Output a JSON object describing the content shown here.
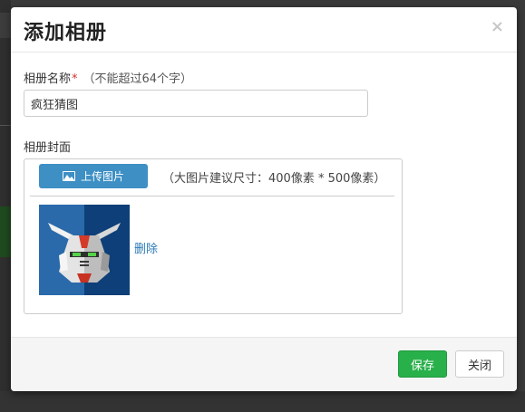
{
  "modal": {
    "title": "添加相册",
    "close_glyph": "×"
  },
  "form": {
    "name_label": "相册名称",
    "required_mark": "*",
    "name_hint": "（不能超过64个字）",
    "name_value": "疯狂猜图",
    "cover_label": "相册封面",
    "upload_button_label": "上传图片",
    "upload_icon": "image-icon",
    "upload_hint": "（大图片建议尺寸：400像素 * 500像素）",
    "delete_label": "删除"
  },
  "footer": {
    "save_label": "保存",
    "close_label": "关闭"
  },
  "colors": {
    "primary": "#3d8fc4",
    "save": "#28b04a",
    "required": "#cc3333",
    "link": "#2a7ab8"
  }
}
